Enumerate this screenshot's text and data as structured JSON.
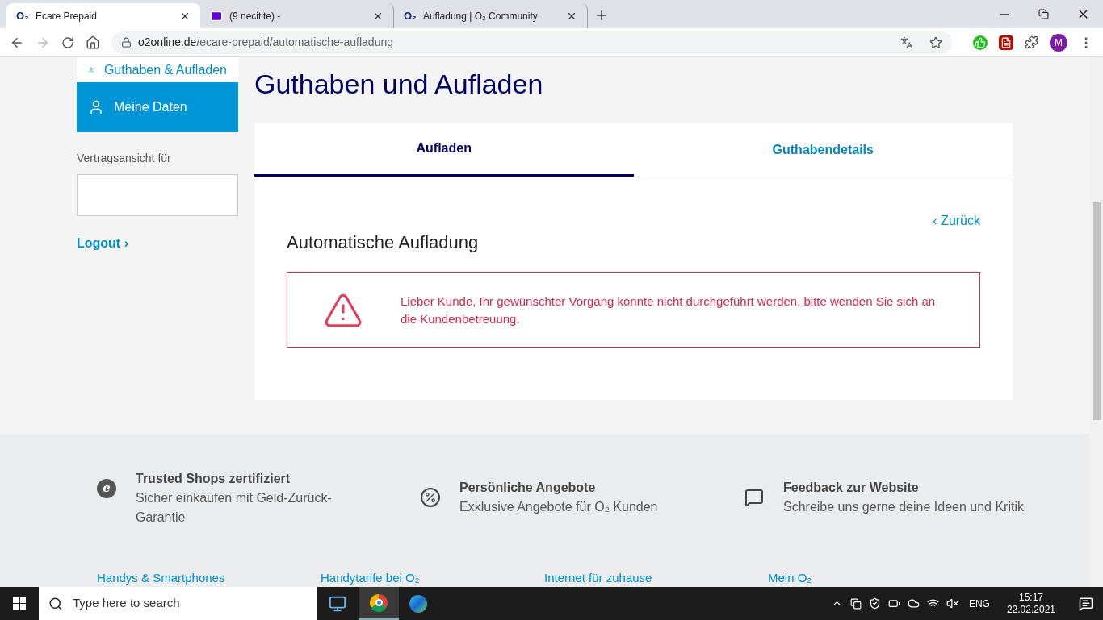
{
  "browser": {
    "tabs": [
      {
        "title": "Ecare Prepaid",
        "kind": "o2",
        "logo": "O₂",
        "selected": true
      },
      {
        "title": "(9 necitite) -",
        "kind": "mail",
        "selected": false
      },
      {
        "title": "Aufladung | O₂ Community",
        "kind": "o2",
        "logo": "O₂",
        "selected": false
      }
    ],
    "url_host": "o2online.de",
    "url_path": "/ecare-prepaid/automatische-aufladung",
    "profile_initial": "M"
  },
  "sidebar": {
    "items": [
      {
        "label": "Guthaben & Aufladen",
        "selected": false
      },
      {
        "label": "Meine Daten",
        "selected": true
      }
    ],
    "contract_label": "Vertragsansicht für",
    "logout": "Logout ›"
  },
  "page_title": "Guthaben und Aufladen",
  "tabs": [
    {
      "label": "Aufladen",
      "selected": true
    },
    {
      "label": "Guthabendetails",
      "selected": false
    }
  ],
  "back_link": "‹ Zurück",
  "section_title": "Automatische Aufladung",
  "error_message": "Lieber Kunde, Ihr gewünschter Vorgang konnte nicht durchgeführt werden, bitte wenden Sie sich an die Kundenbetreuung.",
  "footer": {
    "features": [
      {
        "kind": "trusted",
        "icon_letter": "e",
        "title": "Trusted Shops zertifiziert",
        "text": "Sicher einkaufen mit Geld-Zurück-Garantie"
      },
      {
        "kind": "percent",
        "title": "Persönliche Angebote",
        "text": "Exklusive Angebote für O₂ Kunden"
      },
      {
        "kind": "feedback",
        "title": "Feedback zur Website",
        "text": "Schreibe uns gerne deine Ideen und Kritik"
      }
    ],
    "links": [
      "Handys & Smartphones",
      "Handytarife bei O₂",
      "Internet für zuhause",
      "Mein O₂"
    ]
  },
  "taskbar": {
    "search_placeholder": "Type here to search",
    "language": "ENG",
    "time": "15:17",
    "date": "22.02.2021"
  }
}
